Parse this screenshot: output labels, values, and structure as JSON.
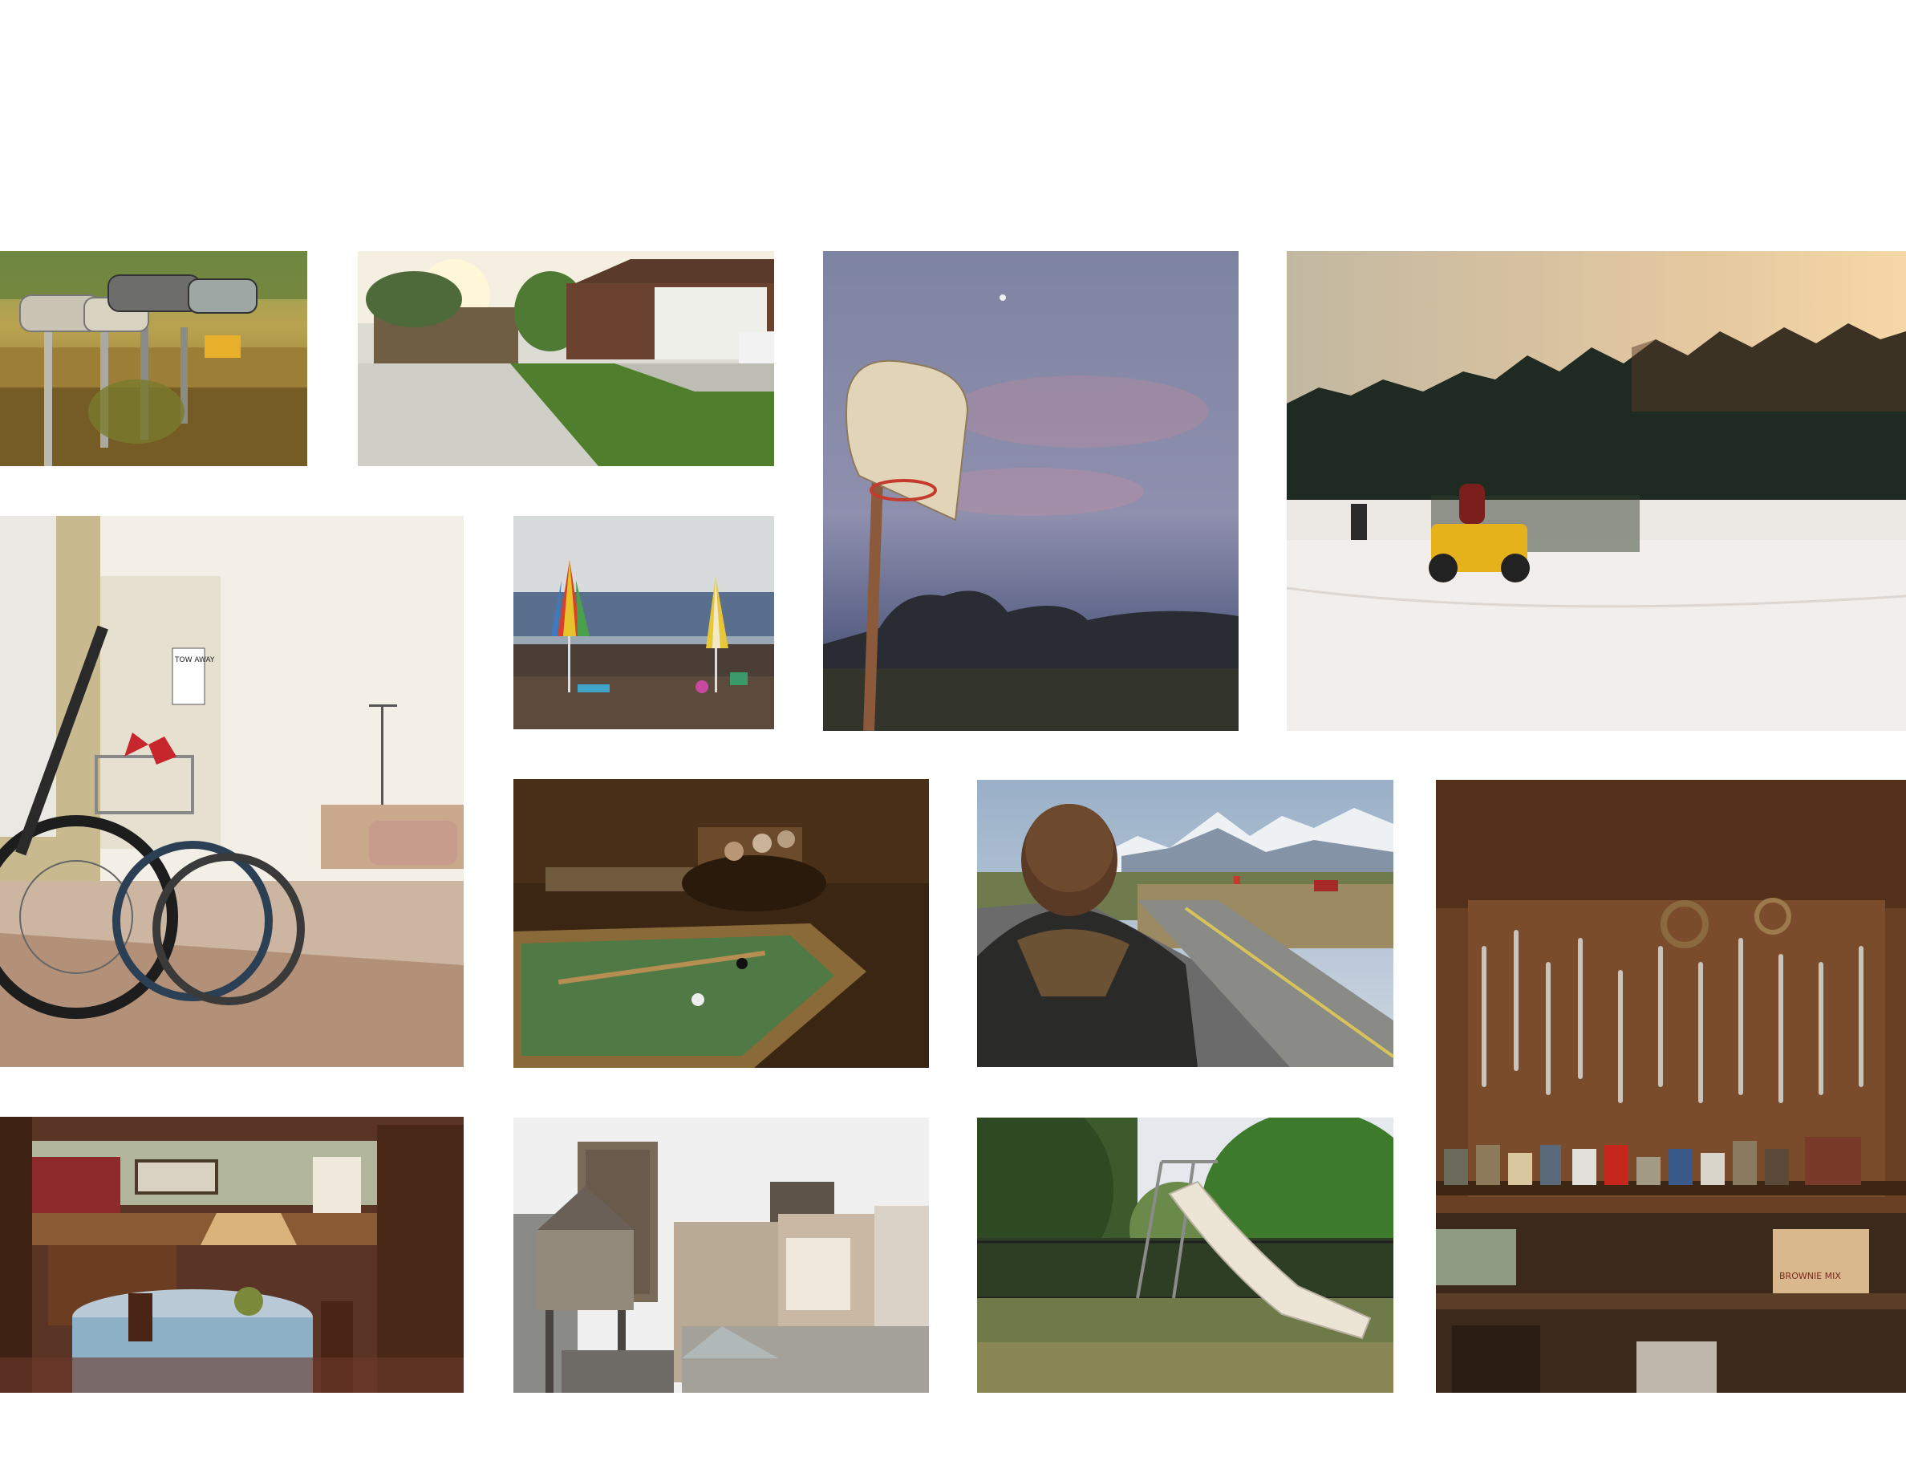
{
  "gallery": {
    "photos": [
      {
        "id": "mailboxes",
        "subject": "rural mailboxes on posts at sunset"
      },
      {
        "id": "driveway",
        "subject": "suburban house garage and driveway"
      },
      {
        "id": "basketball-hoop",
        "subject": "old basketball hoop at dusk"
      },
      {
        "id": "snow-atv",
        "subject": "ATV riders in snowy field by forest"
      },
      {
        "id": "bicycles",
        "subject": "bicycles parked on sidewalk"
      },
      {
        "id": "beach-umbrellas",
        "subject": "striped umbrellas on beach"
      },
      {
        "id": "pool-hall",
        "subject": "pool table and card players"
      },
      {
        "id": "beanie-road",
        "subject": "person in beanie by road and mountains"
      },
      {
        "id": "tool-wall",
        "subject": "workshop wall of hanging tools"
      },
      {
        "id": "kitchen",
        "subject": "cluttered country kitchen and dining table"
      },
      {
        "id": "water-towers",
        "subject": "city rooftops with water towers"
      },
      {
        "id": "playground-slide",
        "subject": "playground slide among trees"
      }
    ]
  },
  "signs": {
    "tow_sign": "TOW AWAY",
    "box_label": "BROWNIE MIX"
  }
}
